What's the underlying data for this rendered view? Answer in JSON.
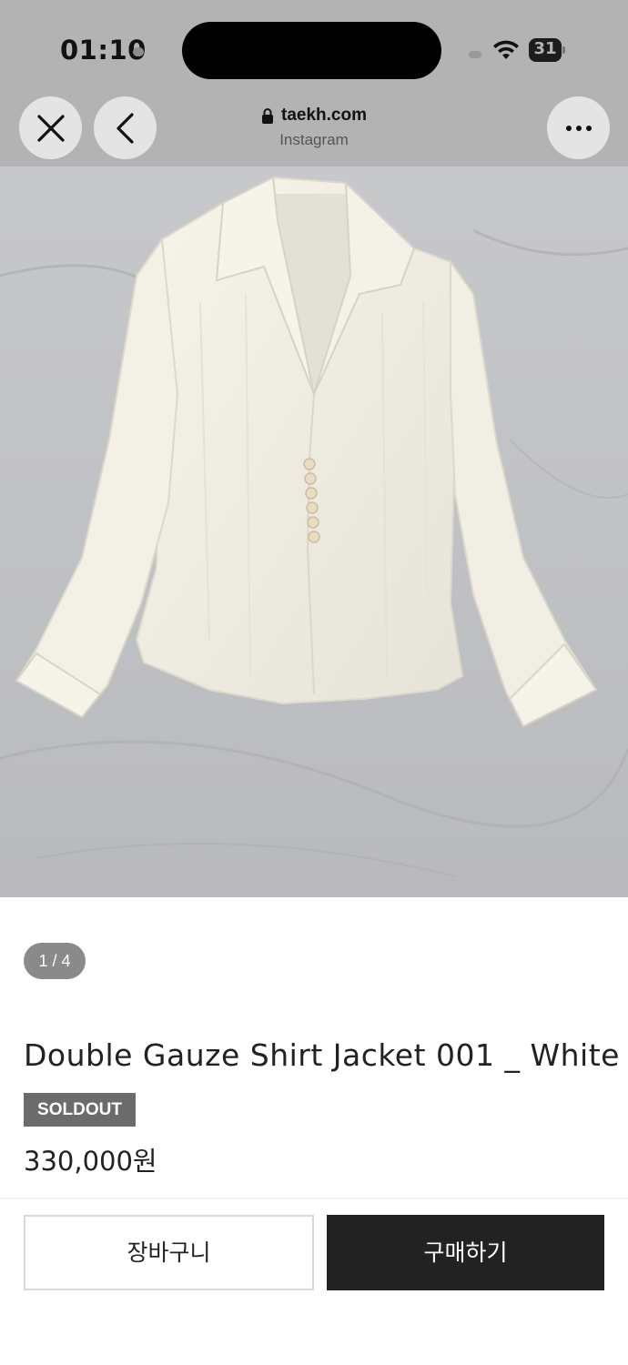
{
  "status_bar": {
    "time": "01:10",
    "battery": "31"
  },
  "browser": {
    "url": "taekh.com",
    "source": "Instagram"
  },
  "icons": {
    "close": "close-icon",
    "back": "chevron-left-icon",
    "more": "more-horizontal-icon",
    "lock": "lock-icon",
    "wifi": "wifi-icon",
    "battery": "battery-icon"
  },
  "product": {
    "image_counter": "1 / 4",
    "title": "Double Gauze Shirt Jacket 001 _ White",
    "status_badge": "SOLDOUT",
    "price": "330,000원"
  },
  "actions": {
    "cart_label": "장바구니",
    "buy_label": "구매하기"
  },
  "colors": {
    "buy_button": "#222222",
    "badge": "#6b6b6b",
    "counter": "#8a8a8a"
  }
}
